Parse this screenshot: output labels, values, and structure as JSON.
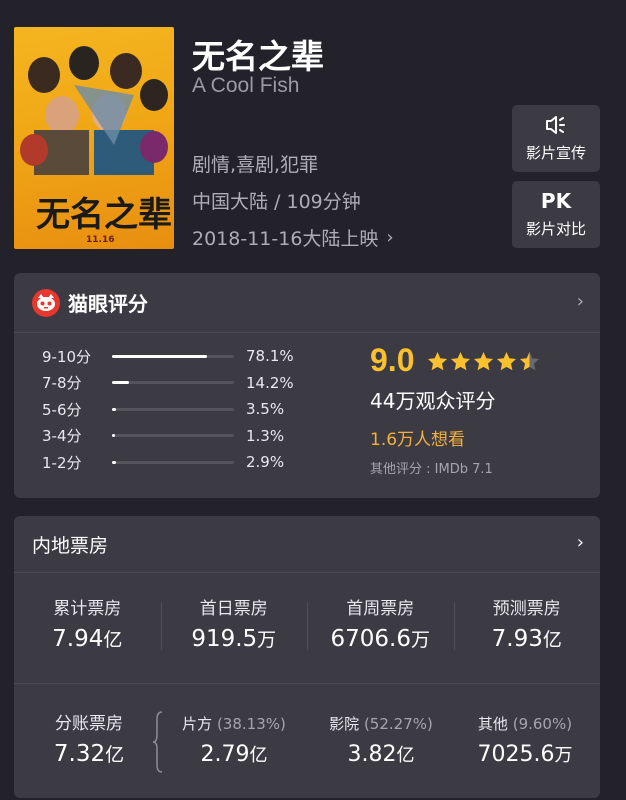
{
  "movie": {
    "title": "无名之辈",
    "english_title": "A Cool Fish",
    "genres": "剧情,喜剧,犯罪",
    "region_duration": "中国大陆 / 109分钟",
    "release": "2018-11-16大陆上映",
    "poster": {
      "title_art": "无名之辈",
      "date_art": "11.16"
    }
  },
  "actions": [
    {
      "icon": "speaker-icon",
      "label": "影片宣传"
    },
    {
      "icon_text": "PK",
      "label": "影片对比"
    }
  ],
  "rating": {
    "header": "猫眼评分",
    "distribution": [
      {
        "label": "9-10分",
        "percent": 78.1,
        "text": "78.1%"
      },
      {
        "label": "7-8分",
        "percent": 14.2,
        "text": "14.2%"
      },
      {
        "label": "5-6分",
        "percent": 3.5,
        "text": "3.5%"
      },
      {
        "label": "3-4分",
        "percent": 1.3,
        "text": "1.3%"
      },
      {
        "label": "1-2分",
        "percent": 2.9,
        "text": "2.9%"
      }
    ],
    "score": "9.0",
    "stars": 4.5,
    "audience": "44万观众评分",
    "want_to_see": "1.6万人想看",
    "other": "其他评分 : IMDb 7.1",
    "colors": {
      "accent": "#fbc02d",
      "want": "#f5b03b",
      "logo": "#e8372d"
    }
  },
  "box_office": {
    "header": "内地票房",
    "stats": [
      {
        "label": "累计票房",
        "value": "7.94",
        "unit": "亿"
      },
      {
        "label": "首日票房",
        "value": "919.5",
        "unit": "万"
      },
      {
        "label": "首周票房",
        "value": "6706.6",
        "unit": "万"
      },
      {
        "label": "预测票房",
        "value": "7.93",
        "unit": "亿"
      }
    ],
    "split": {
      "label": "分账票房",
      "value": "7.32",
      "unit": "亿",
      "parts": [
        {
          "label": "片方",
          "pct": "(38.13%)",
          "value": "2.79",
          "unit": "亿"
        },
        {
          "label": "影院",
          "pct": "(52.27%)",
          "value": "3.82",
          "unit": "亿"
        },
        {
          "label": "其他",
          "pct": "(9.60%)",
          "value": "7025.6",
          "unit": "万"
        }
      ]
    }
  }
}
